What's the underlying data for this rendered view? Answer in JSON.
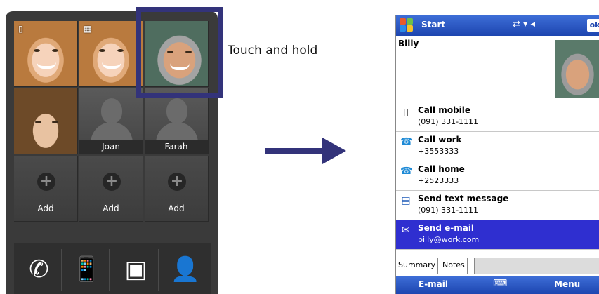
{
  "left_phone": {
    "favorites": [
      {
        "name": "",
        "icon": "phone-sim-icon",
        "photo": "blonde-woman"
      },
      {
        "name": "",
        "icon": "sim-card-icon",
        "photo": "blonde-woman"
      },
      {
        "name": "",
        "icon": "",
        "photo": "older-man"
      },
      {
        "name": "",
        "icon": "",
        "photo": "young-man"
      },
      {
        "name": "Joan",
        "icon": "",
        "photo": "silhouette"
      },
      {
        "name": "Farah",
        "icon": "",
        "photo": "silhouette"
      },
      {
        "name": "Add",
        "icon": "plus-icon",
        "photo": "add"
      },
      {
        "name": "Add",
        "icon": "plus-icon",
        "photo": "add"
      },
      {
        "name": "Add",
        "icon": "plus-icon",
        "photo": "add"
      }
    ],
    "dock": [
      "phone-icon",
      "phone-device-icon",
      "contact-card-icon",
      "remove-contact-icon"
    ]
  },
  "annotation": {
    "touch_label": "Touch and hold",
    "highlight_color": "#33337a",
    "arrow_color": "#33337a"
  },
  "right_phone": {
    "title": "Start",
    "status_icons": [
      "sync-icon",
      "signal-icon",
      "volume-icon"
    ],
    "ok_label": "ok",
    "contact_name": "Billy",
    "actions": [
      {
        "title": "Call mobile",
        "sub": "(091) 331-1111",
        "icon": "mobile-phone-icon",
        "selected": false
      },
      {
        "title": "Call work",
        "sub": "+3553333",
        "icon": "work-phone-icon",
        "selected": false
      },
      {
        "title": "Call home",
        "sub": "+2523333",
        "icon": "home-phone-icon",
        "selected": false
      },
      {
        "title": "Send text message",
        "sub": "(091) 331-1111",
        "icon": "text-message-icon",
        "selected": false
      },
      {
        "title": "Send e-mail",
        "sub": "billy@work.com",
        "icon": "email-icon",
        "selected": true
      }
    ],
    "tabs": [
      "Summary",
      "Notes"
    ],
    "softkeys": {
      "left": "E-mail",
      "right": "Menu",
      "center_icon": "keyboard-icon"
    },
    "accent_color": "#2f2fd0"
  }
}
